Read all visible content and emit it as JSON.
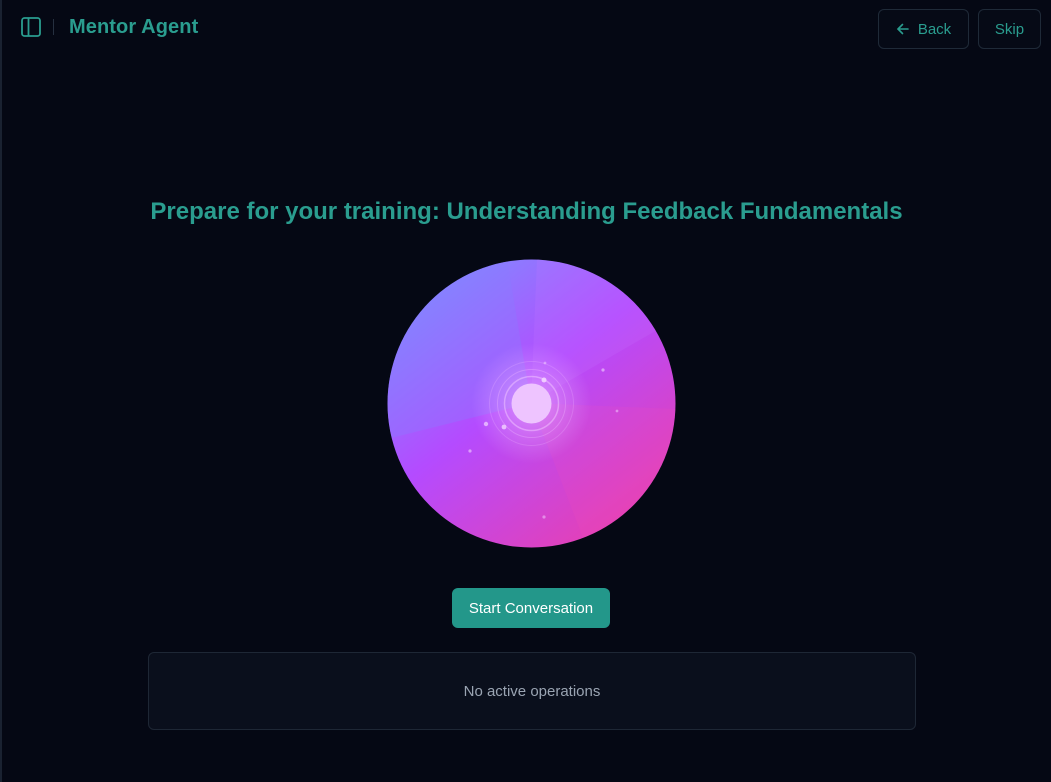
{
  "header": {
    "title": "Mentor Agent",
    "sidebar_toggle_icon": "panel-left-icon",
    "back_label": "Back",
    "back_icon": "arrow-left-icon",
    "skip_label": "Skip"
  },
  "main": {
    "title": "Prepare for your training: Understanding Feedback Fundamentals",
    "start_button_label": "Start Conversation",
    "operations_status": "No active operations"
  },
  "colors": {
    "background": "#050814",
    "accent": "#2a9d8f",
    "button": "#23978a",
    "orb_blue": "#7f8cff",
    "orb_violet": "#b44bff",
    "orb_pink": "#e040b0"
  }
}
